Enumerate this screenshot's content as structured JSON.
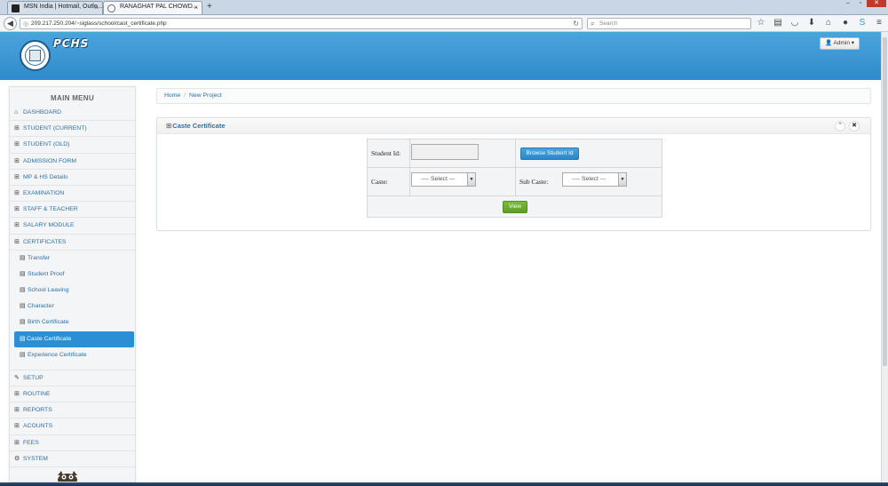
{
  "browser": {
    "tabs": [
      {
        "title": "MSN India | Hotmail, Outlo...",
        "active": false
      },
      {
        "title": "RANAGHAT PAL CHOWD...",
        "active": true
      }
    ],
    "new_tab_symbol": "+",
    "close_symbol": "×",
    "url": "209.217.250.204/~siglass/school/cast_certificate.php",
    "search_placeholder": "Search"
  },
  "header": {
    "brand": "PCHS",
    "admin_label": "Admin"
  },
  "sidebar": {
    "title": "MAIN MENU",
    "items": [
      {
        "label": "DASHBOARD",
        "icon": "home-icon"
      },
      {
        "label": "STUDENT (CURRENT)",
        "icon": "grid-icon"
      },
      {
        "label": "STUDENT (OLD)",
        "icon": "grid-icon"
      },
      {
        "label": "ADMISSION FORM",
        "icon": "grid-icon"
      },
      {
        "label": "MP & HS Details",
        "icon": "grid-icon"
      },
      {
        "label": "EXAMINATION",
        "icon": "grid-icon"
      },
      {
        "label": "STAFF & TEACHER",
        "icon": "grid-icon"
      },
      {
        "label": "SALARY MODULE",
        "icon": "grid-icon"
      },
      {
        "label": "CERTIFICATES",
        "icon": "grid-icon"
      }
    ],
    "certificates_sub": [
      {
        "label": "Transfer"
      },
      {
        "label": "Student Proof"
      },
      {
        "label": "School Leaving"
      },
      {
        "label": "Character"
      },
      {
        "label": "Birth Certificate"
      },
      {
        "label": "Caste Certificate",
        "active": true
      },
      {
        "label": "Experience Certificate"
      }
    ],
    "bottom_items": [
      {
        "label": "SETUP",
        "icon": "wrench-icon"
      },
      {
        "label": "ROUTINE",
        "icon": "grid-icon"
      },
      {
        "label": "REPORTS",
        "icon": "grid-icon"
      },
      {
        "label": "ACOUNTS",
        "icon": "grid-icon"
      },
      {
        "label": "FEES",
        "icon": "grid-icon"
      },
      {
        "label": "SYSTEM",
        "icon": "cogs-icon"
      }
    ]
  },
  "breadcrumb": {
    "home": "Home",
    "separator": "/",
    "current": "New Project"
  },
  "panel": {
    "title": "Caste Certificate",
    "form": {
      "student_id_label": "Student Id:",
      "student_id_value": "",
      "browse_button": "Browse Student Id",
      "caste_label": "Caste:",
      "caste_selected": "---- Select ---",
      "subcaste_label": "Sub Caste:",
      "subcaste_selected": "---- Select ---",
      "view_button": "View"
    }
  },
  "colors": {
    "header_blue": "#2f8bca",
    "active_menu": "#2b8fd5",
    "link": "#2e6fa7",
    "view_green": "#5e9e26"
  }
}
